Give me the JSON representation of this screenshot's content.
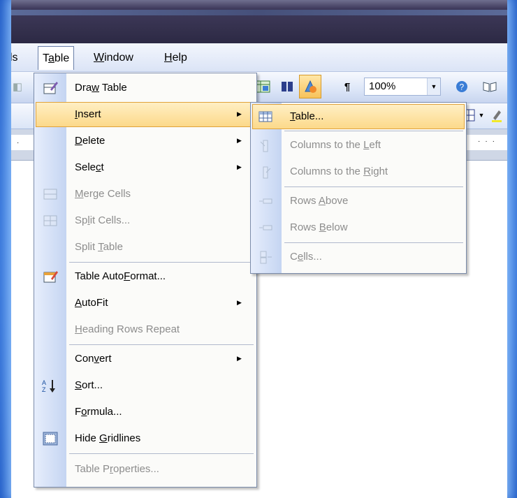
{
  "menubar": {
    "items": [
      {
        "label": "ls"
      },
      {
        "label": "Table"
      },
      {
        "label": "Window"
      },
      {
        "label": "Help"
      }
    ]
  },
  "toolbar": {
    "zoom": "100%",
    "paragraph_mark": "¶"
  },
  "table_menu": {
    "items": [
      {
        "label": "Draw Table",
        "enabled": true
      },
      {
        "label": "Insert",
        "enabled": true,
        "submenu": true
      },
      {
        "label": "Delete",
        "enabled": true,
        "submenu": true
      },
      {
        "label": "Select",
        "enabled": true,
        "submenu": true
      },
      {
        "label": "Merge Cells",
        "enabled": false
      },
      {
        "label": "Split Cells...",
        "enabled": false
      },
      {
        "label": "Split Table",
        "enabled": false
      },
      {
        "label": "Table AutoFormat...",
        "enabled": true
      },
      {
        "label": "AutoFit",
        "enabled": true,
        "submenu": true
      },
      {
        "label": "Heading Rows Repeat",
        "enabled": false
      },
      {
        "label": "Convert",
        "enabled": true,
        "submenu": true
      },
      {
        "label": "Sort...",
        "enabled": true
      },
      {
        "label": "Formula...",
        "enabled": true
      },
      {
        "label": "Hide Gridlines",
        "enabled": true
      },
      {
        "label": "Table Properties...",
        "enabled": false
      }
    ]
  },
  "insert_submenu": {
    "items": [
      {
        "label": "Table...",
        "enabled": true
      },
      {
        "label": "Columns to the Left",
        "enabled": false
      },
      {
        "label": "Columns to the Right",
        "enabled": false
      },
      {
        "label": "Rows Above",
        "enabled": false
      },
      {
        "label": "Rows Below",
        "enabled": false
      },
      {
        "label": "Cells...",
        "enabled": false
      }
    ]
  },
  "colors": {
    "highlight": "#fcd98a",
    "highlight_border": "#e0a23a",
    "disabled_text": "#8d8d8d",
    "frame_blue": "#2f6fd6"
  }
}
